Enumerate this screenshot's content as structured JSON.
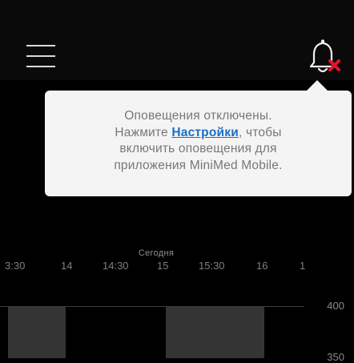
{
  "header": {
    "menu_icon": "hamburger-menu-icon",
    "alert_icon": "bell-muted-icon",
    "alert_badge_color": "#e8112d"
  },
  "notice": {
    "line1": "Оповещения отключены.",
    "line2_before": "Нажмите ",
    "link_text": "Настройки",
    "line2_after": ", чтобы",
    "line3": "включить оповещения для",
    "line4": "приложения MiniMed Mobile."
  },
  "chart": {
    "day_label": "Сегодня",
    "time_ticks": [
      "3:30",
      "14",
      "14:30",
      "15",
      "15:30",
      "16",
      "1"
    ],
    "y_ticks": [
      "400",
      "350"
    ]
  }
}
